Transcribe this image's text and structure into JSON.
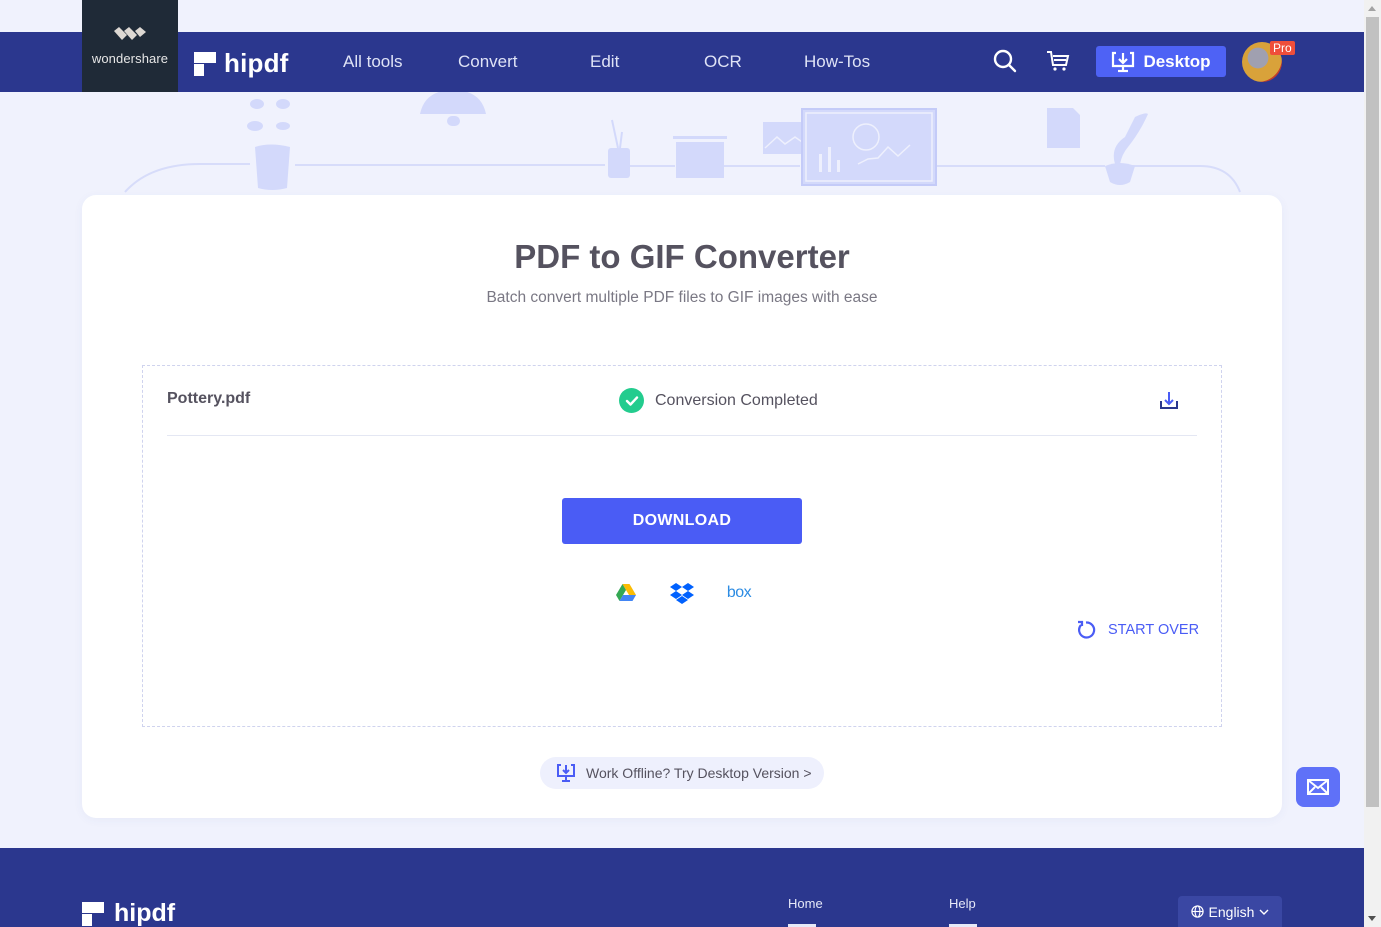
{
  "header": {
    "wondershare_label": "wondershare",
    "brand": "hipdf",
    "nav": [
      {
        "label": "All tools"
      },
      {
        "label": "Convert"
      },
      {
        "label": "Edit"
      },
      {
        "label": "OCR"
      },
      {
        "label": "How-Tos"
      }
    ],
    "icons": {
      "search": "search-icon",
      "cart": "cart-icon"
    },
    "desktop_label": "Desktop",
    "pro_badge": "Pro"
  },
  "main": {
    "title": "PDF to GIF Converter",
    "subtitle": "Batch convert multiple PDF files to GIF images with ease",
    "file": {
      "name": "Pottery.pdf",
      "status": "Conversion Completed"
    },
    "download_label": "DOWNLOAD",
    "cloud_options": [
      {
        "name": "Google Drive"
      },
      {
        "name": "Dropbox"
      },
      {
        "name": "box",
        "label": "box"
      }
    ],
    "start_over_label": "START OVER",
    "offline_label": "Work Offline? Try Desktop Version >"
  },
  "footer": {
    "brand": "hipdf",
    "links": [
      {
        "label": "Home"
      },
      {
        "label": "Help"
      }
    ],
    "language": "English"
  },
  "colors": {
    "brand_navy": "#2b378e",
    "accent_blue": "#4a5cf5",
    "success_green": "#23cc8e",
    "page_bg": "#f0f2fd"
  }
}
